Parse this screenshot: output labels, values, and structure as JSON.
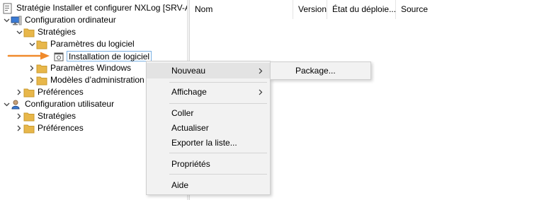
{
  "tree": {
    "root_label": "Stratégie Installer et configurer NXLog [SRV-ADI",
    "computer_config": "Configuration ordinateur",
    "strategies_1": "Stratégies",
    "software_settings": "Paramètres du logiciel",
    "software_installation": "Installation de logiciel",
    "windows_settings": "Paramètres Windows",
    "admin_templates": "Modèles d’administration",
    "preferences_1": "Préférences",
    "user_config": "Configuration utilisateur",
    "strategies_2": "Stratégies",
    "preferences_2": "Préférences"
  },
  "list": {
    "columns": [
      "Nom",
      "Version",
      "État du déploie...",
      "Source"
    ]
  },
  "context_menu": {
    "new": "Nouveau",
    "view": "Affichage",
    "paste": "Coller",
    "refresh": "Actualiser",
    "export": "Exporter la liste...",
    "properties": "Propriétés",
    "help": "Aide"
  },
  "submenu": {
    "package": "Package..."
  },
  "colors": {
    "arrow": "#f08a2b",
    "folder": "#e8b74a",
    "selection_border": "#7ab0e3"
  }
}
